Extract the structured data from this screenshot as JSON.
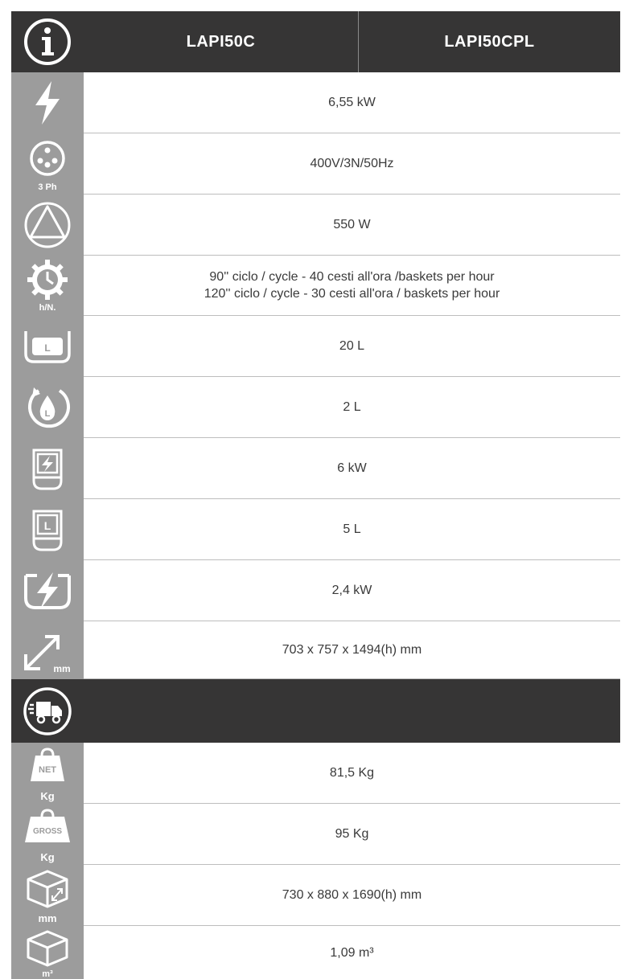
{
  "header": {
    "col1": "LAPI50C",
    "col2": "LAPI50CPL",
    "icon": "info-icon"
  },
  "rows": [
    {
      "icon": "lightning-icon",
      "value": "6,55 kW"
    },
    {
      "icon": "three-phase-plug-icon",
      "icon_label": "3 Ph",
      "value": "400V/3N/50Hz"
    },
    {
      "icon": "pump-triangle-icon",
      "value": "550 W"
    },
    {
      "icon": "cycle-gear-clock-icon",
      "icon_label": "h/N.",
      "value_line1": "90'' ciclo / cycle - 40 cesti all'ora /baskets per hour",
      "value_line2": "120'' ciclo / cycle - 30 cesti all'ora / baskets per hour"
    },
    {
      "icon": "tank-capacity-icon",
      "icon_letter": "L",
      "value": "20 L"
    },
    {
      "icon": "water-consumption-icon",
      "icon_letter": "L",
      "value": "2 L"
    },
    {
      "icon": "boiler-power-icon",
      "value": "6 kW"
    },
    {
      "icon": "boiler-capacity-icon",
      "icon_letter": "L",
      "value": "5 L"
    },
    {
      "icon": "tank-heating-icon",
      "value": "2,4 kW"
    },
    {
      "icon": "dimensions-icon",
      "icon_label": "mm",
      "value": "703 x 757 x 1494(h) mm"
    }
  ],
  "shipping": {
    "icon": "delivery-truck-icon"
  },
  "shipping_rows": [
    {
      "icon": "net-weight-icon",
      "icon_tag": "NET",
      "icon_label": "Kg",
      "value": "81,5 Kg"
    },
    {
      "icon": "gross-weight-icon",
      "icon_tag": "GROSS",
      "icon_label": "Kg",
      "value": "95 Kg"
    },
    {
      "icon": "package-dimensions-icon",
      "icon_label": "mm",
      "value": "730 x 880 x 1690(h) mm"
    },
    {
      "icon": "package-volume-icon",
      "icon_label": "m³",
      "value": "1,09 m³"
    }
  ]
}
